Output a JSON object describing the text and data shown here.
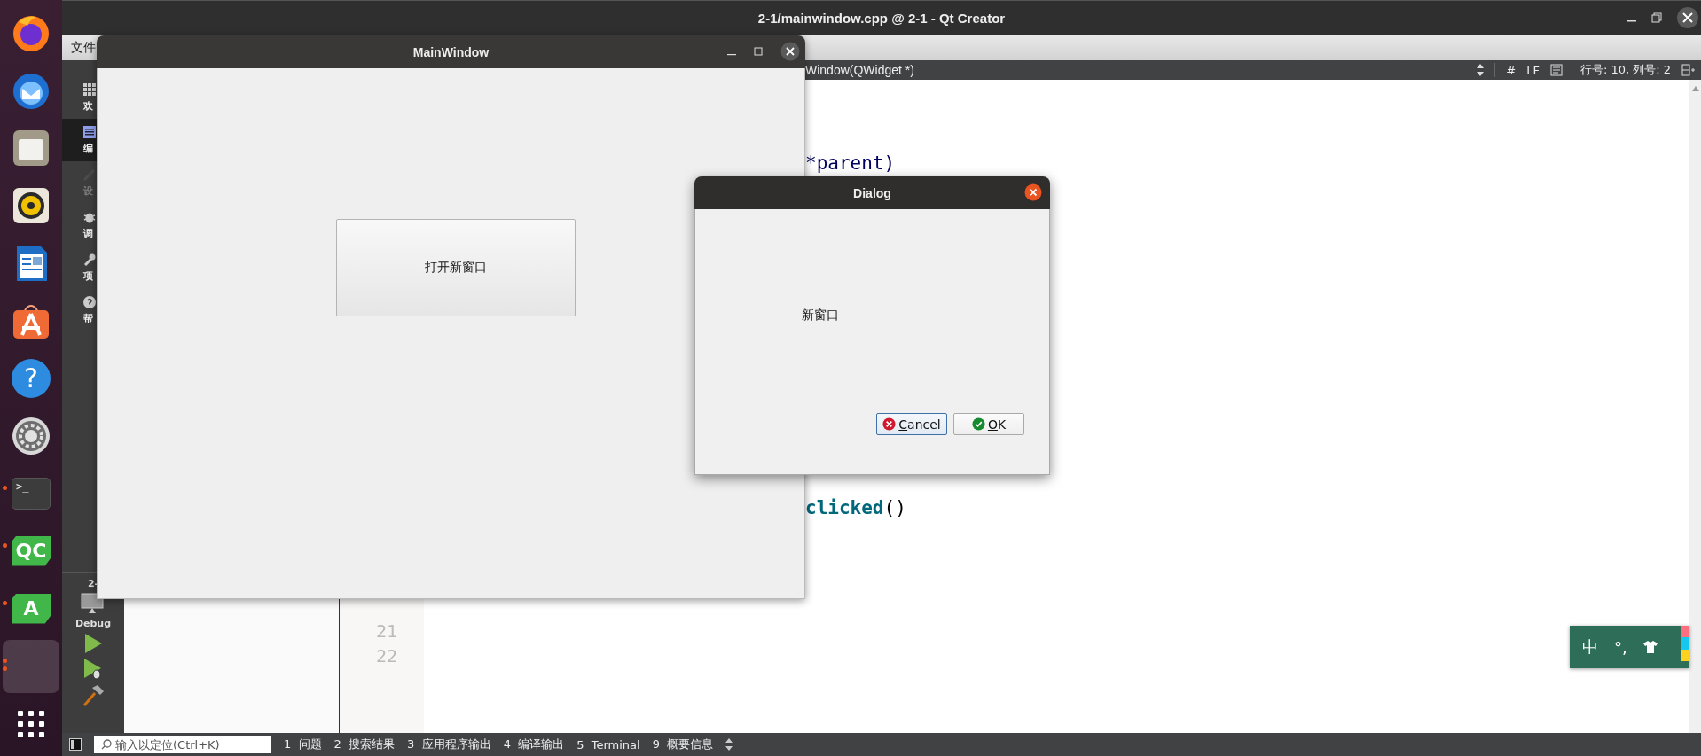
{
  "dock": {
    "items": [
      {
        "kind": "firefox",
        "running": false,
        "selected": false
      },
      {
        "kind": "thunderbird",
        "running": false,
        "selected": false
      },
      {
        "kind": "files",
        "running": false,
        "selected": false
      },
      {
        "kind": "rhythmbox",
        "running": false,
        "selected": false
      },
      {
        "kind": "writer",
        "running": false,
        "selected": false
      },
      {
        "kind": "software",
        "running": false,
        "selected": false
      },
      {
        "kind": "help",
        "label": "?",
        "running": false,
        "selected": false
      },
      {
        "kind": "settings",
        "running": false,
        "selected": false
      },
      {
        "kind": "terminal",
        "label": ">_",
        "running": true,
        "selected": false
      },
      {
        "kind": "qtcreator",
        "label": "QC",
        "running": true,
        "selected": false
      },
      {
        "kind": "android",
        "label": "A",
        "running": true,
        "selected": false
      },
      {
        "kind": "blank",
        "running": true,
        "selected": true
      },
      {
        "kind": "apps",
        "running": false,
        "selected": false
      }
    ]
  },
  "qt_window": {
    "title": "2-1/mainwindow.cpp @ 2-1 - Qt Creator",
    "menu": [
      "文件"
    ],
    "modes": [
      {
        "kind": "welcome",
        "label": "欢",
        "selected": false,
        "disabled": false
      },
      {
        "kind": "edit",
        "label": "编",
        "selected": true,
        "disabled": false
      },
      {
        "kind": "design",
        "label": "设",
        "selected": false,
        "disabled": true
      },
      {
        "kind": "debug",
        "label": "调",
        "selected": false,
        "disabled": false
      },
      {
        "kind": "projects",
        "label": "项",
        "selected": false,
        "disabled": false
      },
      {
        "kind": "help",
        "label": "帮",
        "selected": false,
        "disabled": false
      }
    ],
    "kit": {
      "project": "2-",
      "build": "Debug"
    },
    "editor_toolbar": {
      "function": "Window(QWidget *)",
      "encoding_mark": "#",
      "line_ending": "LF",
      "position": "行号: 10, 列号: 2"
    },
    "editor": {
      "code": [
        {
          "kind": "upper",
          "text": "*parent)"
        },
        {
          "kind": "lower",
          "text": "**clicked**()"
        }
      ],
      "line_numbers": [
        "21",
        "22"
      ]
    },
    "status_bar": {
      "search": {
        "placeholder": "输入以定位(Ctrl+K)"
      },
      "panes": [
        {
          "number": "1",
          "label": "问题"
        },
        {
          "number": "2",
          "label": "搜索结果"
        },
        {
          "number": "3",
          "label": "应用程序输出"
        },
        {
          "number": "4",
          "label": "编译输出"
        },
        {
          "number": "5",
          "label": "Terminal"
        },
        {
          "number": "9",
          "label": "概要信息"
        }
      ]
    }
  },
  "main_window": {
    "title": "MainWindow",
    "button": "打开新窗口"
  },
  "dialog": {
    "title": "Dialog",
    "label": "新窗口",
    "buttons": [
      {
        "kind": "cancel",
        "label": "Cancel",
        "selected": true
      },
      {
        "kind": "ok",
        "label": "OK",
        "selected": false
      }
    ]
  },
  "input_method": {
    "mode": "中",
    "punctuation": "°,"
  }
}
